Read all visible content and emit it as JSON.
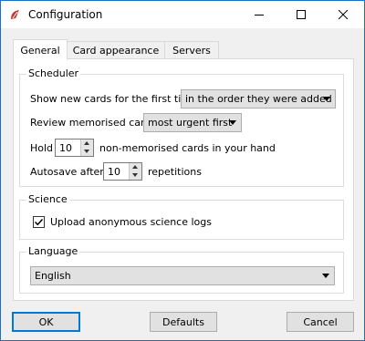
{
  "window": {
    "title": "Configuration",
    "icon": "app-icon"
  },
  "tabs": [
    {
      "label": "General",
      "active": true
    },
    {
      "label": "Card appearance",
      "active": false
    },
    {
      "label": "Servers",
      "active": false
    }
  ],
  "scheduler": {
    "title": "Scheduler",
    "new_cards_label": "Show new cards for the first time",
    "new_cards_value": "in the order they were added",
    "review_label": "Review memorised cards",
    "review_value": "most urgent first",
    "hold_label": "Hold",
    "hold_value": "10",
    "hold_suffix": "non-memorised cards in your hand",
    "autosave_label": "Autosave after",
    "autosave_value": "10",
    "autosave_suffix": "repetitions"
  },
  "science": {
    "title": "Science",
    "upload_label": "Upload anonymous science logs",
    "upload_checked": true
  },
  "language": {
    "title": "Language",
    "value": "English"
  },
  "buttons": {
    "ok": "OK",
    "defaults": "Defaults",
    "cancel": "Cancel"
  }
}
